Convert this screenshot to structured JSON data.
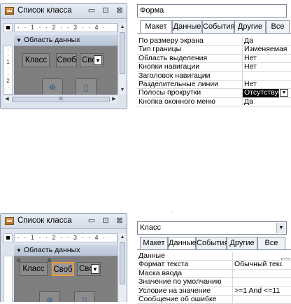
{
  "top": {
    "form_window": {
      "title": "Список класса",
      "min_glyph": "▭",
      "restore_glyph": "⊡",
      "close_glyph": "⊠",
      "ruler_h": "·  ·  1  ·  ·  2  ·  ·  3  ·  ·  4  ·",
      "ruler_v": "·\n·\n1\n·\n·\n2\n·",
      "section_label": "Область данных",
      "controls": {
        "label_klass": "Класс",
        "textbox": "Своб",
        "combo": "Свс"
      },
      "scroll_dots": "III"
    },
    "property_sheet": {
      "selection": "Форма",
      "tabs": [
        "Макет",
        "Данные",
        "События",
        "Другие",
        "Все"
      ],
      "active_tab": 0,
      "rows": [
        {
          "label": "По размеру экрана",
          "value": "Да"
        },
        {
          "label": "Тип границы",
          "value": "Изменяемая"
        },
        {
          "label": "Область выделения",
          "value": "Нет"
        },
        {
          "label": "Кнопки навигации",
          "value": "Нет"
        },
        {
          "label": "Заголовок навигации",
          "value": ""
        },
        {
          "label": "Разделительные линии",
          "value": "Нет"
        },
        {
          "label": "Полосы прокрутки",
          "value": "Отсутствуют"
        },
        {
          "label": "Кнопка оконного меню",
          "value": "Да"
        }
      ]
    }
  },
  "bottom": {
    "form_window": {
      "title": "Список класса",
      "min_glyph": "▭",
      "restore_glyph": "⊡",
      "close_glyph": "⊠",
      "ruler_h": "·  ·  1  ·  ·  2  ·  ·  3  ·  ·  4  ·",
      "section_label": "Область данных",
      "controls": {
        "label_klass": "Класс",
        "textbox": "Своб",
        "combo": "Свс"
      }
    },
    "property_sheet": {
      "selection": "Класс",
      "tabs": [
        "Макет",
        "Данные",
        "События",
        "Другие",
        "Все"
      ],
      "active_tab": 1,
      "rows": [
        {
          "label": "Данные",
          "value": ""
        },
        {
          "label": "Формат текста",
          "value": "Обычный текст"
        },
        {
          "label": "Маска ввода",
          "value": ""
        },
        {
          "label": "Значение по умолчанию",
          "value": ""
        },
        {
          "label": "Условие на значение",
          "value": ">=1 And <=11"
        },
        {
          "label": "Сообщение об ошибке",
          "value": ""
        }
      ]
    },
    "small_mark": "."
  },
  "colors": {
    "selection_orange": "#f29a2e",
    "detail_gray": "#7f7f7f",
    "highlight": "#000000"
  }
}
